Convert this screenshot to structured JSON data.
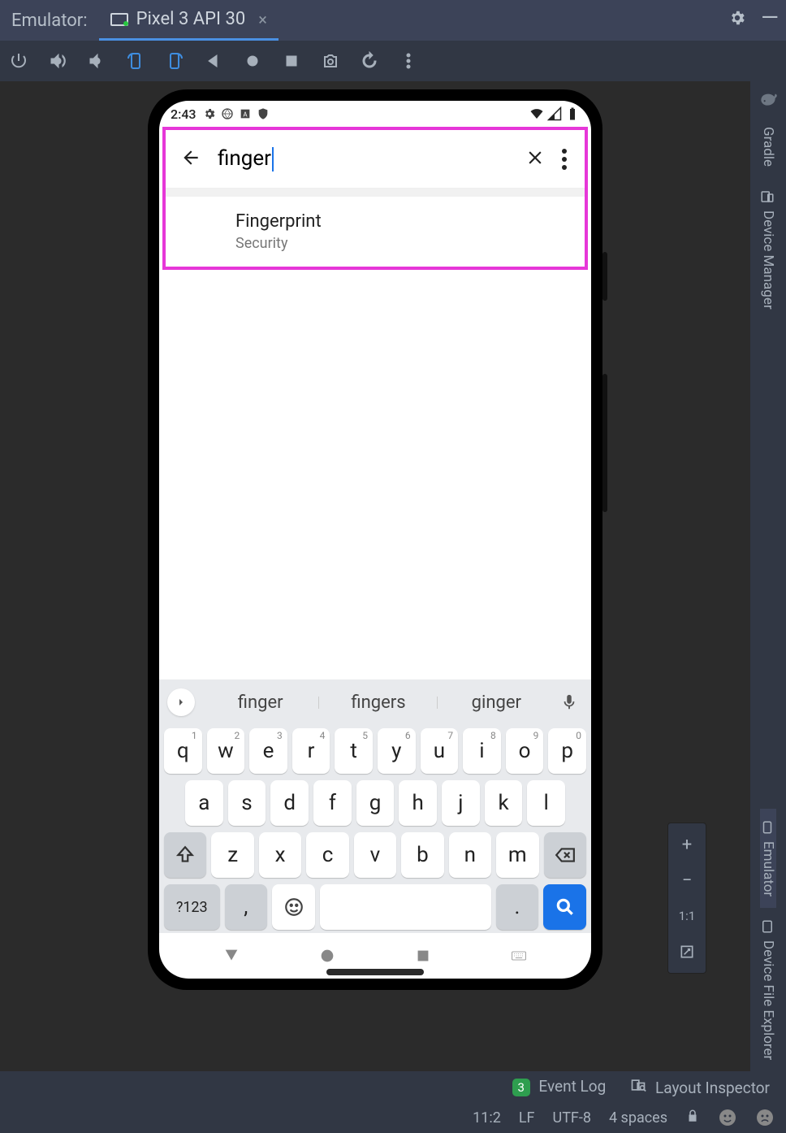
{
  "tabbar": {
    "label": "Emulator:",
    "device": "Pixel 3 API 30"
  },
  "right_rail": {
    "items": [
      "Gradle",
      "Device Manager",
      "Emulator",
      "Device File Explorer"
    ]
  },
  "phone": {
    "status_time": "2:43",
    "search_value": "finger",
    "result": {
      "title": "Fingerprint",
      "subtitle": "Security"
    },
    "suggestions": [
      "finger",
      "fingers",
      "ginger"
    ],
    "keys_row1": [
      {
        "k": "q",
        "s": "1"
      },
      {
        "k": "w",
        "s": "2"
      },
      {
        "k": "e",
        "s": "3"
      },
      {
        "k": "r",
        "s": "4"
      },
      {
        "k": "t",
        "s": "5"
      },
      {
        "k": "y",
        "s": "6"
      },
      {
        "k": "u",
        "s": "7"
      },
      {
        "k": "i",
        "s": "8"
      },
      {
        "k": "o",
        "s": "9"
      },
      {
        "k": "p",
        "s": "0"
      }
    ],
    "keys_row2": [
      "a",
      "s",
      "d",
      "f",
      "g",
      "h",
      "j",
      "k",
      "l"
    ],
    "keys_row3": [
      "z",
      "x",
      "c",
      "v",
      "b",
      "n",
      "m"
    ],
    "key_numsym": "?123",
    "key_comma": ",",
    "key_period": "."
  },
  "zoom": {
    "ratio": "1:1"
  },
  "bottom": {
    "event_count": "3",
    "event_label": "Event Log",
    "layout_label": "Layout Inspector",
    "pos": "11:2",
    "le": "LF",
    "enc": "UTF-8",
    "indent": "4 spaces"
  }
}
